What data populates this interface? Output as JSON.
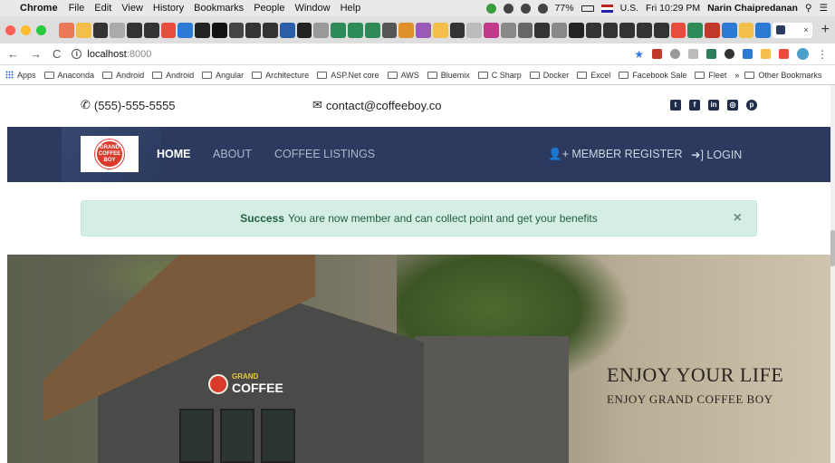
{
  "menubar": {
    "app_name": "Chrome",
    "items": [
      "File",
      "Edit",
      "View",
      "History",
      "Bookmarks",
      "People",
      "Window",
      "Help"
    ],
    "battery": "77%",
    "input_source": "U.S.",
    "clock": "Fri 10:29 PM",
    "user": "Narin Chaipredanan"
  },
  "browser": {
    "url_host": "localhost",
    "url_port": ":8000",
    "bookmarks": [
      "Apps",
      "Anaconda",
      "Android",
      "Android",
      "Angular",
      "Architecture",
      "ASP.Net core",
      "AWS",
      "Bluemix",
      "C Sharp",
      "Docker",
      "Excel",
      "Facebook Sale",
      "Fleet"
    ],
    "other_bookmarks": "Other Bookmarks",
    "overflow": "»"
  },
  "site": {
    "phone": "(555)-555-5555",
    "email": "contact@coffeeboy.co",
    "social_icons": [
      "twitter-icon",
      "facebook-icon",
      "linkedin-icon",
      "instagram-icon",
      "pinterest-icon"
    ],
    "logo_text": "GRAND COFFEE BOY",
    "nav": {
      "home": "HOME",
      "about": "ABOUT",
      "listings": "COFFEE LISTINGS",
      "register": "MEMBER REGISTER",
      "login": "LOGIN"
    },
    "alert": {
      "strong": "Success",
      "message": "You are now member and can collect point and get your benefits",
      "close": "×"
    },
    "hero": {
      "sign_small": "GRAND",
      "sign_big": "COFFEE",
      "title": "ENJOY YOUR LIFE",
      "subtitle": "ENJOY GRAND COFFEE BOY"
    }
  },
  "colors": {
    "nav_bg": "#2b3a5e",
    "alert_bg": "#d4eee4",
    "alert_text": "#1f5d43"
  }
}
